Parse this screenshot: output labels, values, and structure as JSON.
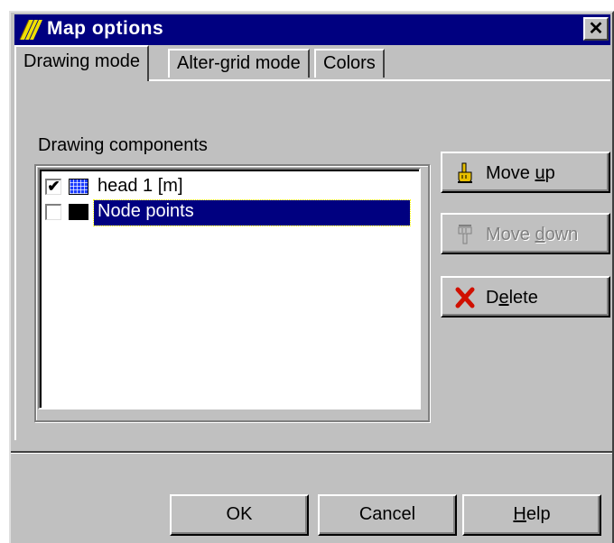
{
  "window": {
    "title": "Map options",
    "close_label": "✕"
  },
  "tabs": [
    {
      "label": "Drawing mode",
      "active": true
    },
    {
      "label": "Alter-grid mode",
      "active": false
    },
    {
      "label": "Colors",
      "active": false
    }
  ],
  "components": {
    "group_label": "Drawing components",
    "items": [
      {
        "label": "head 1 [m]",
        "checked": true,
        "check_mark": "✔",
        "swatch": "grid-icon",
        "color": "#1c3cff",
        "selected": false
      },
      {
        "label": "Node points",
        "checked": false,
        "check_mark": "",
        "swatch": "solid-swatch-icon",
        "color": "#000000",
        "selected": true
      }
    ]
  },
  "side_buttons": {
    "move_up": {
      "prefix": "Move ",
      "accel": "u",
      "suffix": "p",
      "icon": "hand-pointing-up-icon",
      "enabled": true
    },
    "move_down": {
      "prefix": "Move ",
      "accel": "d",
      "suffix": "own",
      "icon": "hand-pointing-down-icon",
      "enabled": false
    },
    "delete": {
      "prefix": "D",
      "accel": "e",
      "suffix": "lete",
      "icon": "red-x-icon",
      "enabled": true
    }
  },
  "footer": {
    "ok_label": "OK",
    "cancel_label": "Cancel",
    "help_accel": "H",
    "help_rest": "elp"
  },
  "colors": {
    "titlebar": "#000080",
    "selection": "#000080",
    "face": "#c0c0c0",
    "delete_icon": "#d01000",
    "hand_icon": "#e8c000"
  }
}
